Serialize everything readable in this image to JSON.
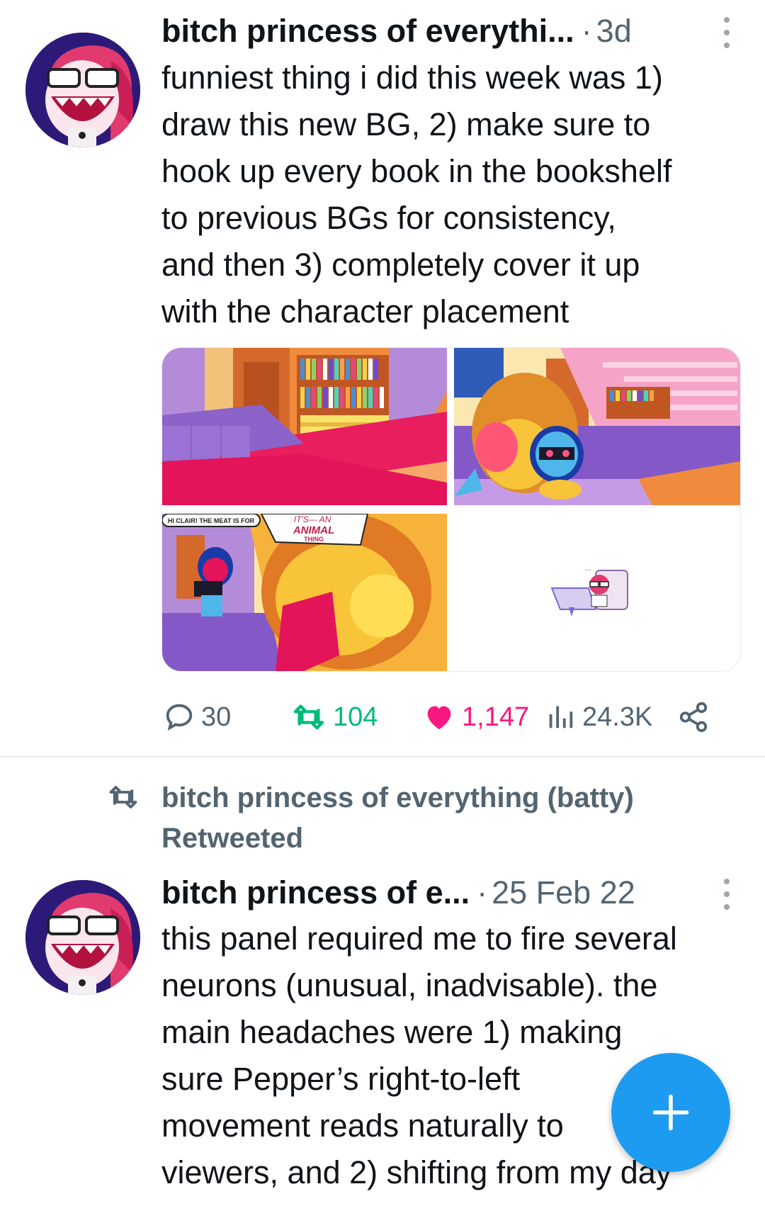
{
  "colors": {
    "text": "#0f1419",
    "secondary": "#536471",
    "accent_blue": "#1d9bf0",
    "retweet_green": "#00ba7c",
    "like_pink": "#f91880"
  },
  "tweets": [
    {
      "author_name": "bitch princess of everythi...",
      "separator": "·",
      "timestamp": "3d",
      "text_lines": [
        "funniest thing i did this week was 1)",
        "draw this new BG, 2) make sure to",
        "hook up every book in the bookshelf",
        "to previous BGs for consistency,",
        "and then 3) completely cover it up",
        "with the character placement"
      ],
      "media": {
        "comic_text": {
          "speech_1": "HI CLAIR! THE MEAT IS FOR",
          "speech_2": "IT'S— AN",
          "speech_3": "ANIMAL",
          "speech_4": "THING",
          "ellipsis": "..."
        }
      },
      "actions": {
        "reply_icon": "reply-icon",
        "reply_count": "30",
        "retweet_icon": "retweet-icon",
        "retweet_count": "104",
        "like_icon": "heart-filled-icon",
        "like_count": "1,147",
        "views_icon": "views-chart-icon",
        "views_count": "24.3K",
        "share_icon": "share-icon"
      }
    },
    {
      "retweeted_by": "bitch princess of everything (batty)",
      "retweeted_label": "Retweeted",
      "author_name": "bitch princess of e...",
      "separator": "·",
      "timestamp": "25 Feb 22",
      "text_lines": [
        "this panel required me to fire several",
        "neurons (unusual, inadvisable). the",
        "main headaches were 1) making",
        "sure Pepper’s right-to-left",
        "movement reads naturally to",
        "viewers, and 2) shifting from my day"
      ]
    }
  ],
  "compose_button": {
    "icon": "plus-icon"
  }
}
